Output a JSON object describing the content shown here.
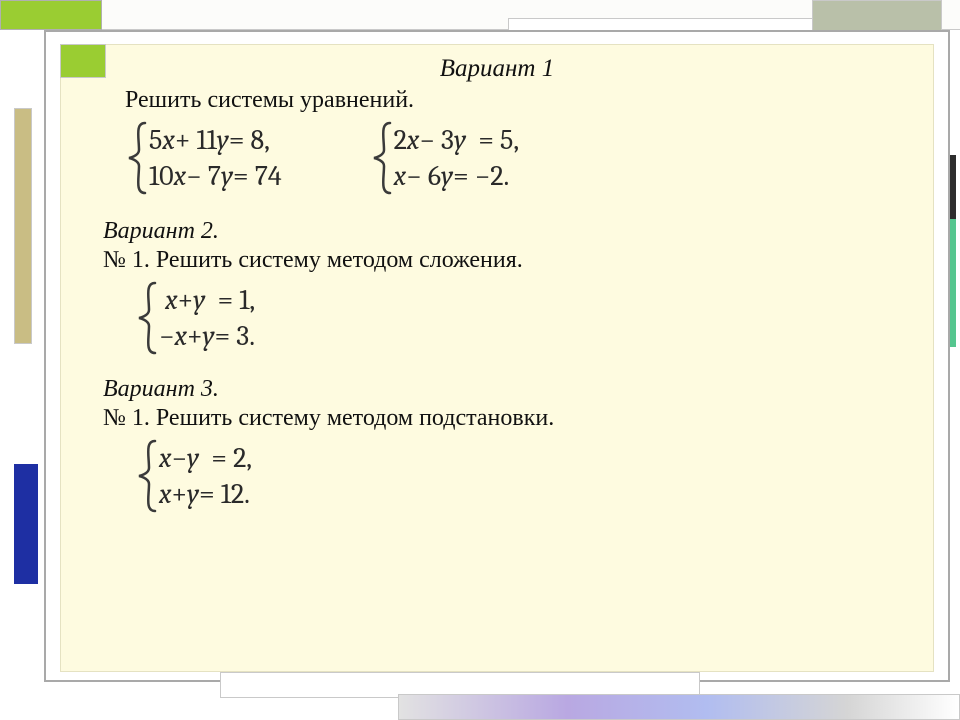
{
  "variant1": {
    "title": "Вариант 1",
    "task": "Решить системы  уравнений.",
    "system_a": {
      "eq1": "5x + 11y = 8,",
      "eq2": "10x − 7y = 74"
    },
    "system_b": {
      "eq1": "2x − 3y  = 5,",
      "eq2": "x − 6y = −2."
    }
  },
  "variant2": {
    "title": "Вариант 2.",
    "task": "№ 1. Решить систему методом сложения.",
    "system": {
      "eq1": " x + y  = 1,",
      "eq2": "−x + y = 3."
    }
  },
  "variant3": {
    "title": "Вариант 3.",
    "task": "№ 1. Решить систему методом подстановки.",
    "system": {
      "eq1": "x − y  = 2,",
      "eq2": "x + y = 12."
    }
  }
}
